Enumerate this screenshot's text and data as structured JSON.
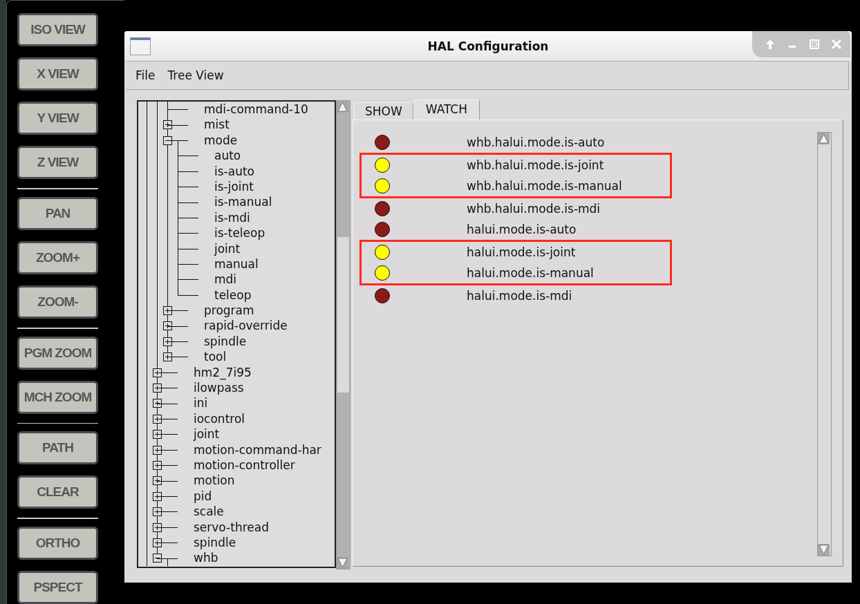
{
  "toolbar": {
    "groups": [
      {
        "buttons": [
          "ISO VIEW",
          "X VIEW",
          "Y VIEW",
          "Z VIEW"
        ]
      },
      {
        "buttons": [
          "PAN",
          "ZOOM+",
          "ZOOM-"
        ]
      },
      {
        "buttons": [
          "PGM ZOOM",
          "MCH ZOOM"
        ]
      },
      {
        "buttons": [
          "PATH",
          "CLEAR"
        ]
      },
      {
        "buttons": [
          "ORTHO",
          "PSPECT"
        ]
      }
    ]
  },
  "window": {
    "title": "HAL Configuration"
  },
  "menu": [
    "File",
    "Tree View"
  ],
  "tree": {
    "items": [
      {
        "children": [
          {
            "label": "mdi-command-10"
          },
          {
            "label": "mist",
            "expanded": false
          },
          {
            "label": "mode",
            "expanded": true,
            "children": [
              {
                "label": "auto"
              },
              {
                "label": "is-auto"
              },
              {
                "label": "is-joint"
              },
              {
                "label": "is-manual"
              },
              {
                "label": "is-mdi"
              },
              {
                "label": "is-teleop"
              },
              {
                "label": "joint"
              },
              {
                "label": "manual"
              },
              {
                "label": "mdi"
              },
              {
                "label": "teleop"
              }
            ]
          },
          {
            "label": "program",
            "expanded": false
          },
          {
            "label": "rapid-override",
            "expanded": false
          },
          {
            "label": "spindle",
            "expanded": false
          },
          {
            "label": "tool",
            "expanded": false
          }
        ]
      },
      {
        "label": "hm2_7i95",
        "expanded": false
      },
      {
        "label": "ilowpass",
        "expanded": false
      },
      {
        "label": "ini",
        "expanded": false
      },
      {
        "label": "iocontrol",
        "expanded": false
      },
      {
        "label": "joint",
        "expanded": false
      },
      {
        "label": "motion-command-har",
        "expanded": false
      },
      {
        "label": "motion-controller",
        "expanded": false
      },
      {
        "label": "motion",
        "expanded": false
      },
      {
        "label": "pid",
        "expanded": false
      },
      {
        "label": "scale",
        "expanded": false
      },
      {
        "label": "servo-thread",
        "expanded": false
      },
      {
        "label": "spindle",
        "expanded": false
      },
      {
        "label": "whb",
        "expanded": true
      }
    ]
  },
  "tabs": [
    {
      "label": "SHOW",
      "selected": false
    },
    {
      "label": "WATCH",
      "selected": true
    }
  ],
  "watch": [
    {
      "name": "whb.halui.mode.is-auto",
      "on": false,
      "highlighted": false
    },
    {
      "name": "whb.halui.mode.is-joint",
      "on": true,
      "highlighted": true
    },
    {
      "name": "whb.halui.mode.is-manual",
      "on": true,
      "highlighted": true
    },
    {
      "name": "whb.halui.mode.is-mdi",
      "on": false,
      "highlighted": false
    },
    {
      "name": "halui.mode.is-auto",
      "on": false,
      "highlighted": false
    },
    {
      "name": "halui.mode.is-joint",
      "on": true,
      "highlighted": true
    },
    {
      "name": "halui.mode.is-manual",
      "on": true,
      "highlighted": true
    },
    {
      "name": "halui.mode.is-mdi",
      "on": false,
      "highlighted": false
    }
  ]
}
